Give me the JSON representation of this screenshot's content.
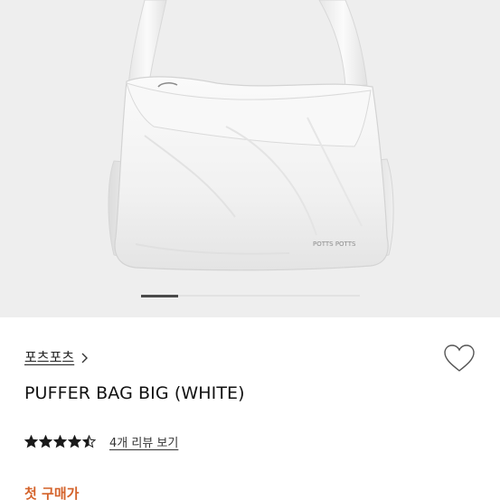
{
  "product": {
    "brand": "포츠포츠",
    "title": "PUFFER BAG BIG (WHITE)",
    "bag_print": "POTTS POTTS",
    "rating": 4.5,
    "review_link": "4개 리뷰 보기",
    "first_purchase_label": "첫 구매가"
  },
  "carousel": {
    "current_index": 1,
    "progress_fraction": 0.17
  },
  "icons": {
    "brand_chevron": "chevron-right-icon",
    "wishlist": "heart-outline-icon",
    "rating": "star-icon"
  },
  "colors": {
    "accent": "#d4622a",
    "star": "#1a1a1a",
    "hero_bg": "#eeeeee"
  }
}
